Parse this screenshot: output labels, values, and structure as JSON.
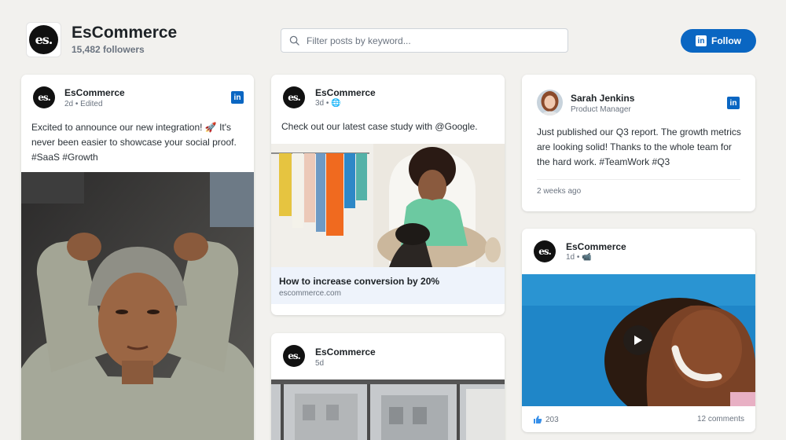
{
  "header": {
    "logo_text": "es.",
    "brand_name": "EsCommerce",
    "followers": "15,482 followers",
    "search_placeholder": "Filter posts by keyword...",
    "follow_label": "Follow",
    "linkedin_letters": "in",
    "accent_color": "#0a66c2"
  },
  "posts": [
    {
      "author": "EsCommerce",
      "meta": "2d • Edited",
      "text": "Excited to announce our new integration! 🚀 It's never been easier to showcase your social proof. #SaaS #Growth",
      "media": "photo"
    },
    {
      "author": "EsCommerce",
      "meta": "3d • 🌐",
      "text": "Check out our latest case study with @Google.",
      "link_title": "How to increase conversion by 20%",
      "link_domain": "escommerce.com",
      "media": "photo"
    },
    {
      "author": "EsCommerce",
      "meta": "5d",
      "media": "photo"
    },
    {
      "author": "Sarah Jenkins",
      "role": "Product Manager",
      "text": "Just published our Q3 report. The growth metrics are looking solid! Thanks to the whole team for the hard work. #TeamWork #Q3",
      "time": "2 weeks ago"
    },
    {
      "author": "EsCommerce",
      "meta": "1d • 📹",
      "media": "video",
      "likes": "203",
      "comments": "12 comments"
    }
  ]
}
